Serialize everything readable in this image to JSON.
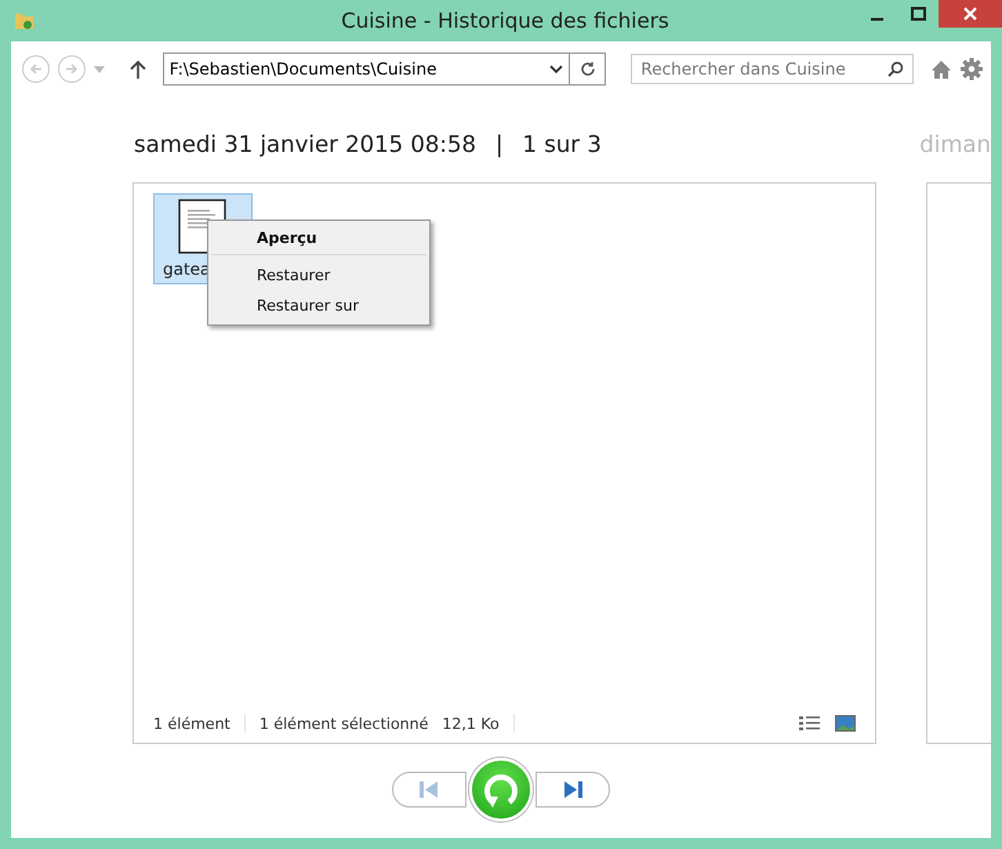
{
  "window": {
    "title": "Cuisine - Historique des fichiers"
  },
  "toolbar": {
    "back_disabled": true,
    "forward_disabled": true,
    "address": "F:\\Sebastien\\Documents\\Cuisine",
    "search": {
      "placeholder": "Rechercher dans Cuisine"
    }
  },
  "snapshot": {
    "date": "samedi 31 janvier 2015 08:58",
    "separator": "|",
    "position": "1 sur 3"
  },
  "next_snapshot": {
    "date": "diman"
  },
  "files": [
    {
      "name": "gatea",
      "selected": true
    }
  ],
  "context_menu": {
    "items": [
      {
        "label": "Aperçu",
        "default": true,
        "divider_after": true
      },
      {
        "label": "Restaurer",
        "default": false,
        "divider_after": false
      },
      {
        "label": "Restaurer sur",
        "default": false,
        "divider_after": false
      }
    ]
  },
  "status_bar": {
    "count": "1 élément",
    "selection": "1 élément sélectionné",
    "size": "12,1 Ko"
  },
  "navigation": {
    "previous_disabled": true,
    "next_disabled": false
  }
}
